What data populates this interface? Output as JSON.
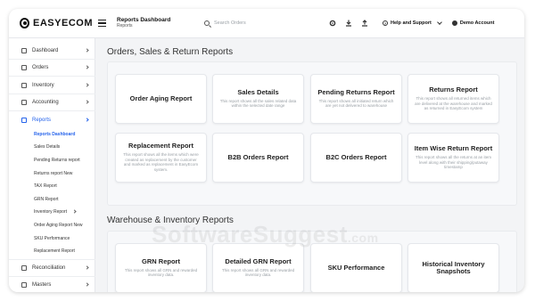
{
  "app": {
    "brand": "EASYECOM"
  },
  "header": {
    "title": "Reports Dashboard",
    "subtitle": "Reports",
    "search_placeholder": "Search Orders",
    "help_label": "Help and Support",
    "account_label": "Demo Account",
    "icons": [
      "gear-icon",
      "download-icon",
      "upload-icon"
    ]
  },
  "sidebar": {
    "items": [
      {
        "label": "Dashboard"
      },
      {
        "label": "Orders"
      },
      {
        "label": "Inventory"
      },
      {
        "label": "Accounting"
      },
      {
        "label": "Reports"
      },
      {
        "label": "Reconciliation"
      },
      {
        "label": "Masters"
      }
    ],
    "sub_items": [
      {
        "label": "Reports Dashboard"
      },
      {
        "label": "Sales Details"
      },
      {
        "label": "Pending Returns report"
      },
      {
        "label": "Returns report New"
      },
      {
        "label": "TAX Report"
      },
      {
        "label": "GRN Report"
      },
      {
        "label": "Inventory Report"
      },
      {
        "label": "Order Aging Report New"
      },
      {
        "label": "SKU Performance"
      },
      {
        "label": "Replacement Report"
      }
    ]
  },
  "sections": [
    {
      "title": "Orders, Sales & Return Reports",
      "cards": [
        {
          "title": "Order Aging Report",
          "desc": ""
        },
        {
          "title": "Sales Details",
          "desc": "This report shows all the sales related data within the selected date range"
        },
        {
          "title": "Pending Returns Report",
          "desc": "This report shows all initiated return which are yet not delivered to warehouse"
        },
        {
          "title": "Returns Report",
          "desc": "This report shows all returned items which are delivered at the warehouse and marked as returned in EasyEcom system"
        },
        {
          "title": "Replacement Report",
          "desc": "This report shows all the items which were created as replacement by the customer and marked as replacement in EasyEcom system."
        },
        {
          "title": "B2B Orders Report",
          "desc": ""
        },
        {
          "title": "B2C Orders Report",
          "desc": ""
        },
        {
          "title": "Item Wise Return Report",
          "desc": "This report shows all the returns at an item level along with their shipping/putaway timestamp"
        }
      ]
    },
    {
      "title": "Warehouse & Inventory Reports",
      "cards": [
        {
          "title": "GRN Report",
          "desc": "This report shows all GRN and rewarded inventory data."
        },
        {
          "title": "Detailed GRN Report",
          "desc": "This report shows all GRN and rewarded inventory data."
        },
        {
          "title": "SKU Performance",
          "desc": ""
        },
        {
          "title": "Historical Inventory Snapshots",
          "desc": ""
        }
      ]
    }
  ],
  "watermark": {
    "main": "SoftwareSuggest",
    "suffix": ".com"
  }
}
